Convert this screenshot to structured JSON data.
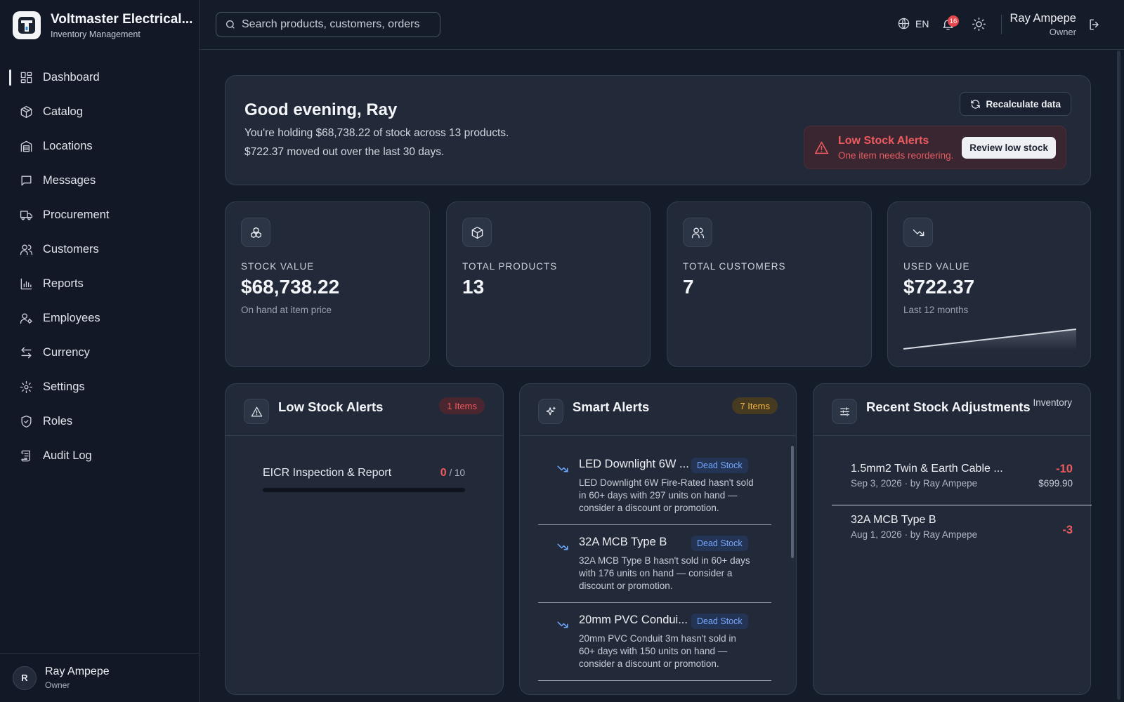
{
  "brand": {
    "name": "Voltmaster Electrical...",
    "subtitle": "Inventory Management"
  },
  "sidebar": {
    "items": [
      {
        "label": "Dashboard",
        "icon": "dashboard-icon",
        "active": true
      },
      {
        "label": "Catalog",
        "icon": "box-icon"
      },
      {
        "label": "Locations",
        "icon": "warehouse-icon"
      },
      {
        "label": "Messages",
        "icon": "message-icon"
      },
      {
        "label": "Procurement",
        "icon": "truck-icon"
      },
      {
        "label": "Customers",
        "icon": "users-icon"
      },
      {
        "label": "Reports",
        "icon": "bar-chart-icon"
      },
      {
        "label": "Employees",
        "icon": "user-cog-icon"
      },
      {
        "label": "Currency",
        "icon": "swap-icon"
      },
      {
        "label": "Settings",
        "icon": "gear-icon"
      },
      {
        "label": "Roles",
        "icon": "shield-icon"
      },
      {
        "label": "Audit Log",
        "icon": "scroll-icon"
      }
    ],
    "user": {
      "initial": "R",
      "name": "Ray Ampepe",
      "role": "Owner"
    }
  },
  "header": {
    "search_placeholder": "Search products, customers, orders",
    "language": "EN",
    "notification_count": "16",
    "user": {
      "name": "Ray Ampepe",
      "role": "Owner"
    }
  },
  "greeting": {
    "title": "Good evening, Ray",
    "line1": "You're holding $68,738.22 of stock across 13 products.",
    "line2": "$722.37 moved out over the last 30 days.",
    "recalc_label": "Recalculate data",
    "alert": {
      "title": "Low Stock Alerts",
      "subtitle": "One item needs reordering.",
      "button": "Review low stock"
    }
  },
  "stats": [
    {
      "icon": "cubes-icon",
      "label": "STOCK VALUE",
      "value": "$68,738.22",
      "sub": "On hand at item price"
    },
    {
      "icon": "box-icon",
      "label": "TOTAL PRODUCTS",
      "value": "13",
      "sub": ""
    },
    {
      "icon": "users-icon",
      "label": "TOTAL CUSTOMERS",
      "value": "7",
      "sub": ""
    },
    {
      "icon": "trend-down-icon",
      "label": "USED VALUE",
      "value": "$722.37",
      "sub": "Last 12 months"
    }
  ],
  "low_stock": {
    "title": "Low Stock Alerts",
    "badge": "1 Items",
    "items": [
      {
        "name": "EICR Inspection & Report",
        "qty": "0",
        "max": "/ 10",
        "fill": 0
      }
    ]
  },
  "smart_alerts": {
    "title": "Smart Alerts",
    "badge": "7 Items",
    "items": [
      {
        "title": "LED Downlight 6W ...",
        "tag": "Dead Stock",
        "desc": "LED Downlight 6W Fire-Rated hasn't sold in 60+ days with 297 units on hand — consider a discount or promotion."
      },
      {
        "title": "32A MCB Type B",
        "tag": "Dead Stock",
        "desc": "32A MCB Type B hasn't sold in 60+ days with 176 units on hand — consider a discount or promotion."
      },
      {
        "title": "20mm PVC Condui...",
        "tag": "Dead Stock",
        "desc": "20mm PVC Conduit 3m hasn't sold in 60+ days with 150 units on hand — consider a discount or promotion."
      }
    ]
  },
  "adjustments": {
    "title": "Recent Stock Adjustments",
    "link": "Inventory",
    "items": [
      {
        "name": "1.5mm2 Twin & Earth Cable ...",
        "meta": "Sep 3, 2026 · by Ray Ampepe",
        "qty": "-10",
        "price": "$699.90"
      },
      {
        "name": "32A MCB Type B",
        "meta": "Aug 1, 2026 · by Ray Ampepe",
        "qty": "-3",
        "price": ""
      }
    ]
  },
  "colors": {
    "accent_red": "#ef5a5f",
    "accent_amber": "#f1b541",
    "accent_blue": "#6ea8ff"
  }
}
